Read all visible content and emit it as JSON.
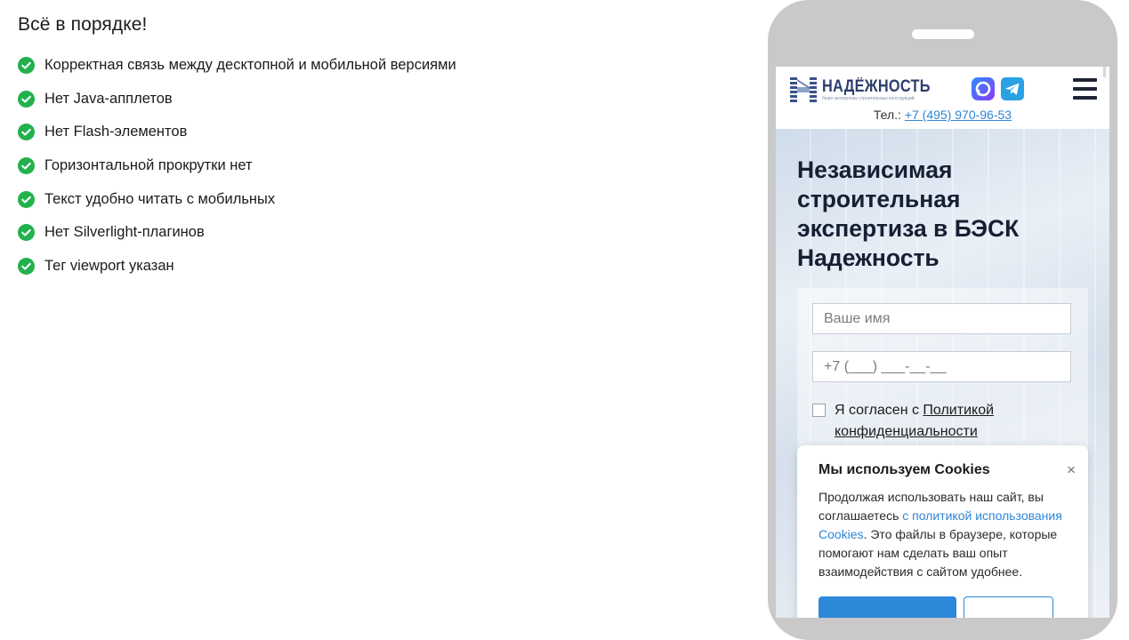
{
  "results": {
    "title": "Всё в порядке!",
    "items": [
      "Корректная связь между десктопной и мобильной версиями",
      "Нет Java-апплетов",
      "Нет Flash-элементов",
      "Горизонтальной прокрутки нет",
      "Текст удобно читать с мобильных",
      "Нет Silverlight-плагинов",
      "Тег viewport указан"
    ],
    "icon": "check-circle-icon",
    "icon_color": "#22b14c"
  },
  "site": {
    "logo": {
      "name": "НАДЁЖНОСТЬ",
      "tagline": "бюро экспертизы строительных конструкций"
    },
    "phone_label": "Тел.:",
    "phone_number": "+7 (495) 970-96-53",
    "social": [
      "max-messenger-icon",
      "telegram-icon"
    ],
    "menu_icon": "hamburger-menu-icon",
    "hero_title": "Независимая строительная экспертиза в БЭСК Надежность",
    "form": {
      "name_placeholder": "Ваше имя",
      "phone_placeholder": "+7 (___) ___-__-__",
      "consent_prefix": "Я согласен с ",
      "consent_link": "Политикой конфиденциальности"
    },
    "cookie": {
      "title": "Мы используем Cookies",
      "text_before": "Продолжая использовать наш сайт, вы соглашаетесь ",
      "link": "с политикой использования Cookies",
      "text_after": ". Это файлы в браузере, которые помогают нам сделать ваш опыт взаимодействия с сайтом удобнее.",
      "accept_label": "",
      "settings_label": ""
    },
    "colors": {
      "accent": "#2c88d9",
      "link": "#2f86d6",
      "heading": "#172033"
    }
  }
}
